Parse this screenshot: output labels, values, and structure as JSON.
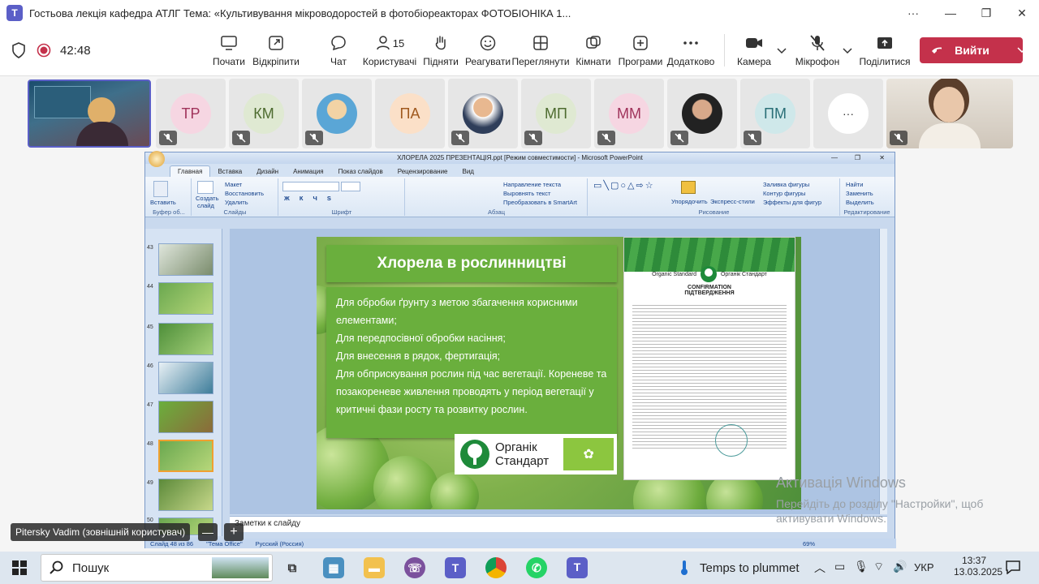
{
  "window": {
    "title": "Гостьова лекція кафедра АТЛГ Тема: «Культивування мікроводоростей в фотобіореакторах ФОТОБІОНІКА 1...",
    "more": "···",
    "minimize": "—",
    "restore": "❐",
    "close": "✕"
  },
  "meeting": {
    "timer": "42:48",
    "toolbar": {
      "start": "Почати",
      "popout": "Відкріпити",
      "chat": "Чат",
      "people_count": "15",
      "people": "Користувачі",
      "raise": "Підняти",
      "react": "Реагувати",
      "view": "Переглянути",
      "rooms": "Кімнати",
      "apps": "Програми",
      "more": "Додатково",
      "camera": "Камера",
      "mic": "Мікрофон",
      "share": "Поділитися",
      "leave": "Вийти"
    },
    "participants": [
      {
        "initials": "TP"
      },
      {
        "initials": "КМ"
      },
      {
        "initials": ""
      },
      {
        "initials": "ПА"
      },
      {
        "initials": ""
      },
      {
        "initials": "МП"
      },
      {
        "initials": "ММ"
      },
      {
        "initials": ""
      },
      {
        "initials": "ПМ"
      },
      {
        "initials": "···"
      }
    ],
    "presenter_name": "Pitersky Vadim (зовнішній користувач)"
  },
  "ppt": {
    "title": "ХЛОРЕЛА 2025 ПРЕЗЕНТАЦІЯ.ppt [Режим совместимости] - Microsoft PowerPoint",
    "tabs": [
      "Главная",
      "Вставка",
      "Дизайн",
      "Анимация",
      "Показ слайдов",
      "Рецензирование",
      "Вид"
    ],
    "groups": {
      "clipboard": "Буфер об...",
      "slides": "Слайды",
      "font": "Шрифт",
      "paragraph": "Абзац",
      "drawing": "Рисование",
      "editing": "Редактирование"
    },
    "ribbon": {
      "paste": "Вставить",
      "create": "Создать",
      "slide": "слайд",
      "layout": "Макет",
      "restore": "Восстановить",
      "delete": "Удалить",
      "text_dir": "Направление текста",
      "align_text": "Выровнять текст",
      "smartart": "Преобразовать в SmartArt",
      "arrange": "Упорядочить",
      "express": "Экспресс-стили",
      "fill": "Заливка фигуры",
      "outline": "Контур фигуры",
      "effects": "Эффекты для фигур",
      "find": "Найти",
      "replace": "Заменить",
      "select": "Выделить"
    },
    "thumbnails": [
      "43",
      "44",
      "45",
      "46",
      "47",
      "48",
      "49",
      "50"
    ],
    "slide": {
      "title": "Хлорела в рослинництві",
      "bullets": [
        "Для обробки ґрунту з метою збагачення корисними елементами;",
        "Для передпосівної обробки насіння;",
        "Для внесення в рядок, фертигація;",
        "Для обприскування рослин під час вегетації. Кореневе та позакореневе живлення проводять у період вегетації у критичні фази росту та розвитку рослин."
      ],
      "logo_line1": "Органік",
      "logo_line2": "Стандарт",
      "cert_brand_en": "Organic Standard",
      "cert_brand_ua": "Органік Стандарт",
      "cert_title1": "CONFIRMATION",
      "cert_title2": "ПІДТВЕРДЖЕННЯ"
    },
    "notes": "Заметки к слайду",
    "status_slide": "Слайд 48 из 86",
    "status_theme": "\"Тема Office\"",
    "status_lang": "Русский (Россия)",
    "zoom": "69%"
  },
  "activation": {
    "line1": "Активація Windows",
    "line2": "Перейдіть до розділу \"Настройки\", щоб",
    "line3": "активувати Windows."
  },
  "taskbar": {
    "search": "Пошук",
    "weather": "Temps to plummet",
    "lang": "УКР",
    "time": "13:37",
    "date": "13.03.2025"
  }
}
